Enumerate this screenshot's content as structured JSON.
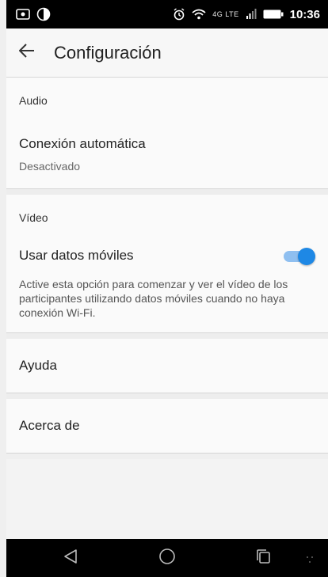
{
  "status_bar": {
    "time": "10:36",
    "network": "4G LTE",
    "icons": [
      "screenshot-icon",
      "moon-icon",
      "alarm-icon",
      "wifi-icon",
      "signal-icon",
      "battery-icon"
    ]
  },
  "app_bar": {
    "title": "Configuración",
    "back_icon": "arrow-left-icon"
  },
  "sections": {
    "audio": {
      "header": "Audio",
      "auto_connect": {
        "title": "Conexión automática",
        "value": "Desactivado"
      }
    },
    "video": {
      "header": "Vídeo",
      "mobile_data": {
        "title": "Usar datos móviles",
        "enabled": true,
        "description": "Active esta opción para comenzar y ver el vídeo de los participantes utilizando datos móviles cuando no haya conexión Wi-Fi."
      }
    },
    "help": {
      "label": "Ayuda"
    },
    "about": {
      "label": "Acerca de"
    }
  },
  "colors": {
    "accent": "#1e88e5",
    "accent_track": "#8fbff0",
    "status_bar": "#000000",
    "nav_bar": "#000000"
  },
  "nav_bar": {
    "buttons": [
      "back-triangle-icon",
      "home-circle-icon",
      "recents-square-icon"
    ]
  }
}
